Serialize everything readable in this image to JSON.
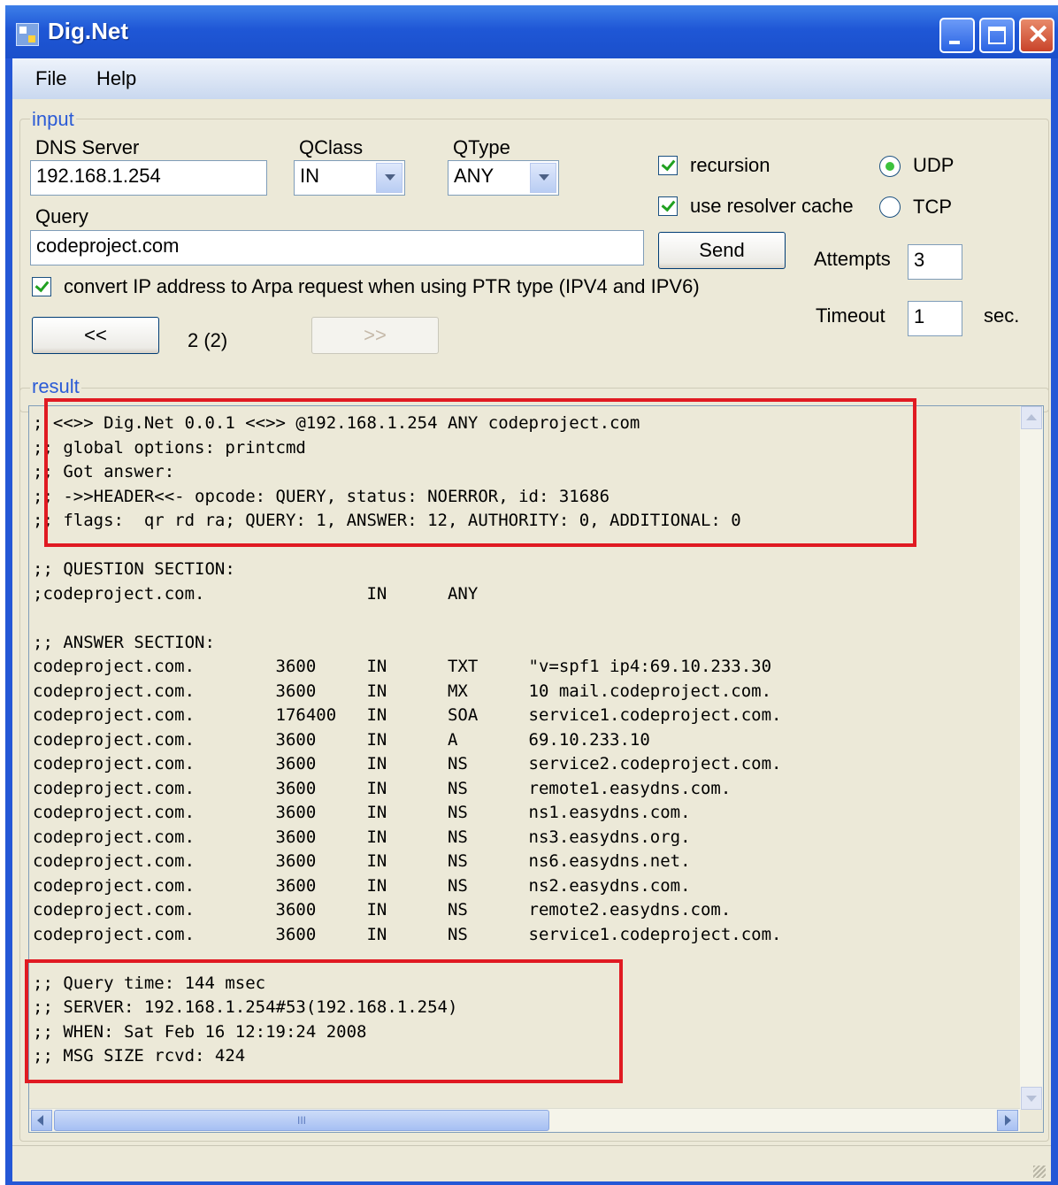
{
  "window": {
    "title": "Dig.Net"
  },
  "menu": {
    "items": [
      "File",
      "Help"
    ]
  },
  "input": {
    "group_label": "input",
    "dns_server_label": "DNS Server",
    "dns_server_value": "192.168.1.254",
    "qclass_label": "QClass",
    "qclass_value": "IN",
    "qtype_label": "QType",
    "qtype_value": "ANY",
    "query_label": "Query",
    "query_value": "codeproject.com",
    "recursion_label": "recursion",
    "recursion_checked": true,
    "resolver_cache_label": "use resolver cache",
    "resolver_cache_checked": true,
    "udp_label": "UDP",
    "tcp_label": "TCP",
    "protocol_selected": "UDP",
    "send_label": "Send",
    "attempts_label": "Attempts",
    "attempts_value": "3",
    "timeout_label": "Timeout",
    "timeout_value": "1",
    "timeout_unit": "sec.",
    "arpa_label": "convert IP address to Arpa request when using PTR type (IPV4 and IPV6)",
    "arpa_checked": true,
    "prev_label": "<<",
    "next_label": ">>",
    "page_indicator": "2 (2)"
  },
  "result": {
    "group_label": "result",
    "text": "; <<>> Dig.Net 0.0.1 <<>> @192.168.1.254 ANY codeproject.com\n;; global options: printcmd\n;; Got answer:\n;; ->>HEADER<<- opcode: QUERY, status: NOERROR, id: 31686\n;; flags:  qr rd ra; QUERY: 1, ANSWER: 12, AUTHORITY: 0, ADDITIONAL: 0\n\n;; QUESTION SECTION:\n;codeproject.com.                IN      ANY\n\n;; ANSWER SECTION:\ncodeproject.com.        3600     IN      TXT     \"v=spf1 ip4:69.10.233.30\ncodeproject.com.        3600     IN      MX      10 mail.codeproject.com.\ncodeproject.com.        176400   IN      SOA     service1.codeproject.com.\ncodeproject.com.        3600     IN      A       69.10.233.10\ncodeproject.com.        3600     IN      NS      service2.codeproject.com.\ncodeproject.com.        3600     IN      NS      remote1.easydns.com.\ncodeproject.com.        3600     IN      NS      ns1.easydns.com.\ncodeproject.com.        3600     IN      NS      ns3.easydns.org.\ncodeproject.com.        3600     IN      NS      ns6.easydns.net.\ncodeproject.com.        3600     IN      NS      ns2.easydns.com.\ncodeproject.com.        3600     IN      NS      remote2.easydns.com.\ncodeproject.com.        3600     IN      NS      service1.codeproject.com.\n\n;; Query time: 144 msec\n;; SERVER: 192.168.1.254#53(192.168.1.254)\n;; WHEN: Sat Feb 16 12:19:24 2008\n;; MSG SIZE rcvd: 424",
    "hscroll_grip": "III"
  },
  "colors": {
    "title_bar": "#2457d6",
    "highlight_box": "#e01a22",
    "group_label": "#2b5bd6"
  }
}
